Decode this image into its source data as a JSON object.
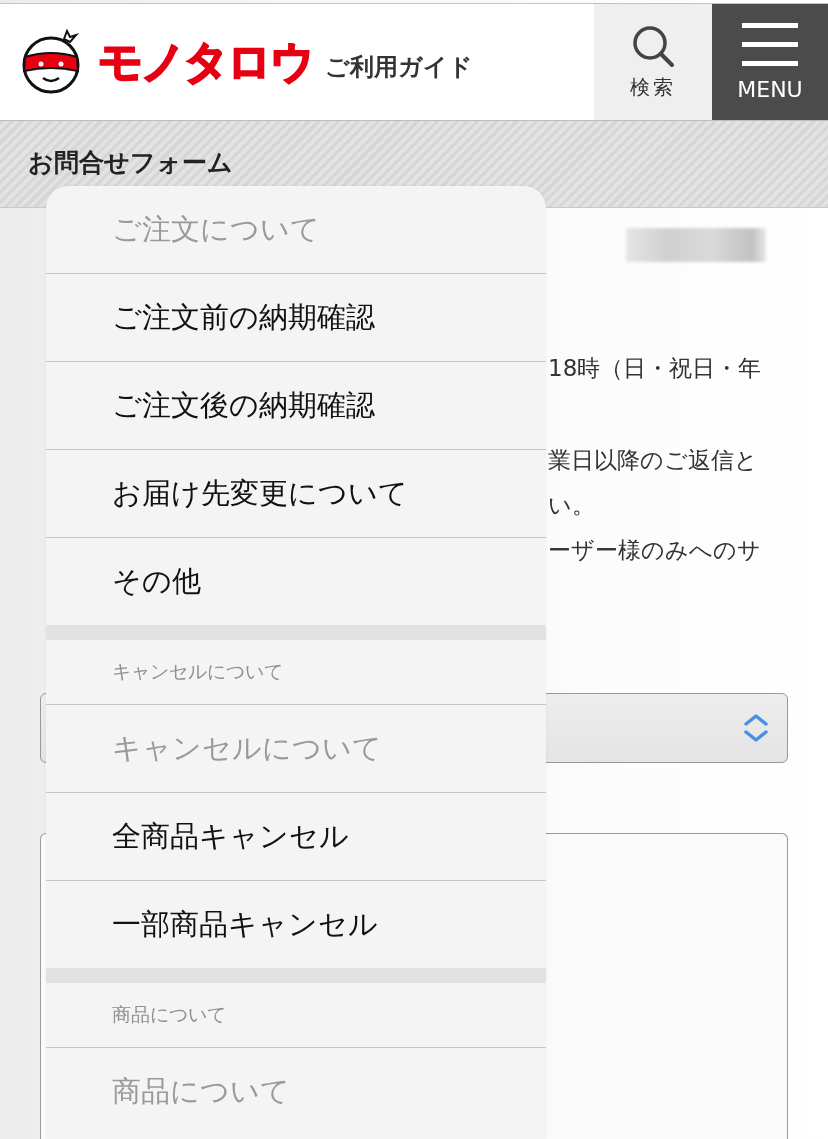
{
  "header": {
    "logo_text": "モノタロウ",
    "guide_label": "ご利用ガイド",
    "search_button": "検索",
    "menu_button": "MENU"
  },
  "page_title": "お問合せフォーム",
  "background_paragraphs": [
    [
      "18時（日・祝日・年"
    ],
    [
      "業日以降のご返信と",
      "い。",
      "ーザー様のみへのサ"
    ]
  ],
  "picker": {
    "groups": [
      {
        "options": [
          {
            "label": "ご注文について",
            "disabled": true
          },
          {
            "label": "ご注文前の納期確認",
            "disabled": false
          },
          {
            "label": "ご注文後の納期確認",
            "disabled": false
          },
          {
            "label": "お届け先変更について",
            "disabled": false
          },
          {
            "label": "その他",
            "disabled": false
          }
        ]
      },
      {
        "label": "キャンセルについて",
        "options": [
          {
            "label": "キャンセルについて",
            "disabled": true
          },
          {
            "label": "全商品キャンセル",
            "disabled": false
          },
          {
            "label": "一部商品キャンセル",
            "disabled": false
          }
        ]
      },
      {
        "label": "商品について",
        "options": [
          {
            "label": "商品について",
            "disabled": true
          }
        ]
      }
    ]
  }
}
